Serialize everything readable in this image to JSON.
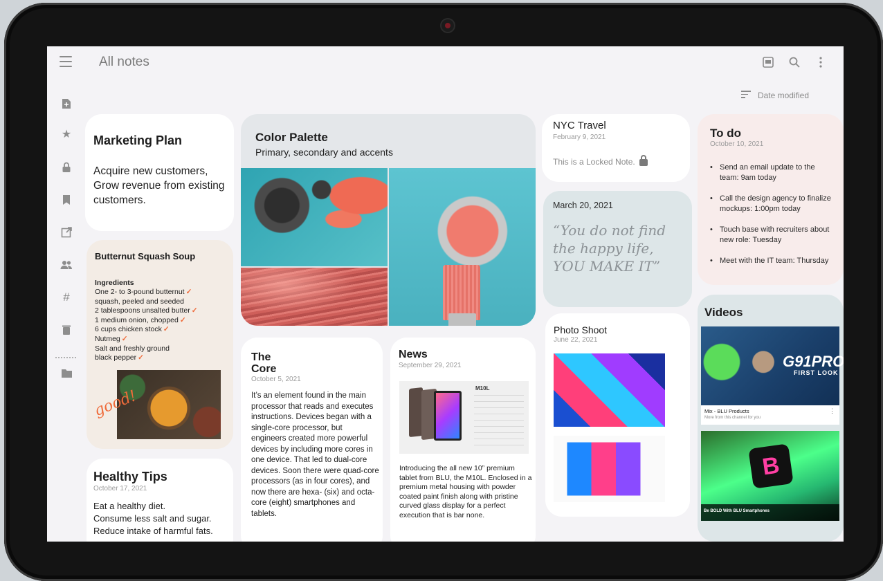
{
  "header": {
    "title": "All notes",
    "sort_label": "Date modified"
  },
  "icons": {
    "menu": "hamburger-icon",
    "pdf": "pdf-icon",
    "search": "search-icon",
    "more": "more-vertical-icon"
  },
  "cards": {
    "marketing": {
      "title": "Marketing Plan",
      "body": "Acquire new customers, Grow revenue from existing customers."
    },
    "soup": {
      "title": "Butternut Squash Soup",
      "subtitle": "Ingredients",
      "lines": [
        "One 2- to 3-pound butternut",
        "squash, peeled and seeded",
        "2 tablespoons unsalted butter",
        "1 medium onion, chopped",
        "6 cups chicken stock",
        "Nutmeg",
        "Salt and freshly ground",
        "black pepper"
      ],
      "handwritten": "good!"
    },
    "healthy": {
      "title": "Healthy Tips",
      "date": "October 17, 2021",
      "lines": [
        "Eat a healthy diet.",
        "Consume less salt and sugar.",
        "Reduce intake of harmful fats."
      ]
    },
    "palette": {
      "title": "Color Palette",
      "subtitle": "Primary, secondary and accents"
    },
    "core": {
      "title_line1": "The",
      "title_line2": "Core",
      "date": "October 5, 2021",
      "body": "It’s an element found in the main processor that reads and executes instructions. Devices began with a single-core processor, but engineers created more powerful devices by including more cores in one device. That led to dual-core devices. Soon there were quad-core processors (as in four cores), and now there are hexa- (six) and octa-core (eight) smartphones and tablets."
    },
    "news": {
      "title": "News",
      "date": "September 29, 2021",
      "spec_model": "M10L",
      "body": "Introducing the all new 10” premium tablet from BLU, the M10L. Enclosed in a premium metal housing with powder coated paint finish along with pristine curved glass display for a perfect execution that is bar none."
    },
    "nyc": {
      "title": "NYC Travel",
      "date": "February 9, 2021",
      "body": "This is a Locked Note."
    },
    "quote": {
      "date": "March 20, 2021",
      "text": "“You do not find the happy life, YOU MAKE IT”"
    },
    "photo": {
      "title": "Photo Shoot",
      "date": "June 22, 2021"
    },
    "todo": {
      "title": "To do",
      "date": "October 10, 2021",
      "items": [
        "Send an email update to the team: 9am today",
        "Call the design agency to finalize mockups: 1:00pm today",
        "Touch base with recruiters about new role: Tuesday",
        "Meet with the IT team: Thursday"
      ]
    },
    "videos": {
      "title": "Videos",
      "video1_overlay": "G91PRO",
      "video1_overlay_sub": "FIRST LOOK",
      "video1_title": "Mix - BLU Products",
      "video1_sub": "More from this channel for you",
      "video2_logo": "B",
      "video2_title": "Be BOLD With BLU Smartphones"
    }
  },
  "colors": {
    "screen_bg": "#f4f3f6",
    "accent_orange": "#ef6b3a",
    "todo_bg": "#f8eceb",
    "videos_bg": "#dde6e8"
  }
}
